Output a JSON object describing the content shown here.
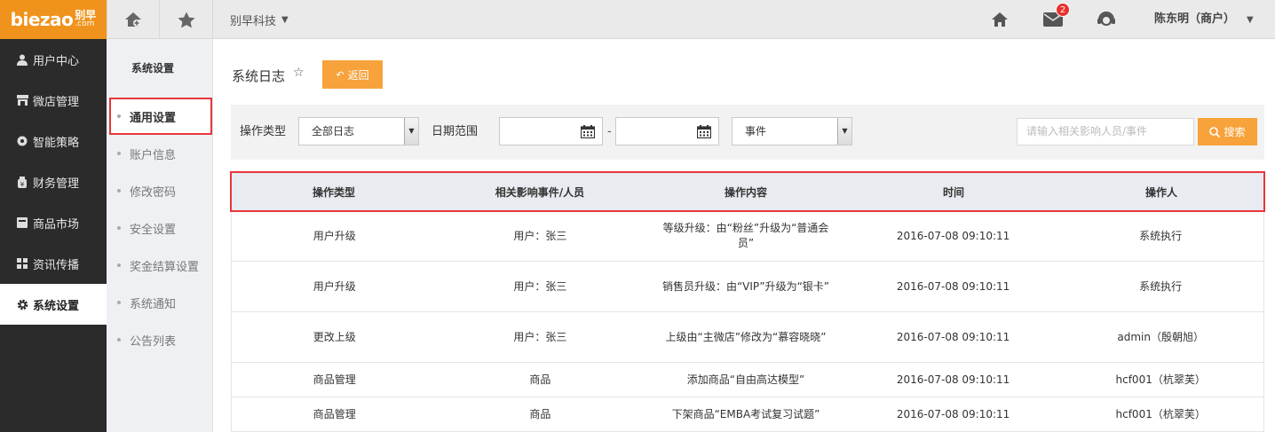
{
  "brand": {
    "logo_main": "biezao",
    "logo_cn": "别早",
    "logo_domain": ".com",
    "color": "#f0931c"
  },
  "topbar": {
    "company": "别早科技",
    "mail_badge": "2",
    "user": "陈东明（商户）"
  },
  "leftnav": {
    "items": [
      {
        "label": "用户中心",
        "icon": "user-icon"
      },
      {
        "label": "微店管理",
        "icon": "store-icon"
      },
      {
        "label": "智能策略",
        "icon": "bulb-icon"
      },
      {
        "label": "财务管理",
        "icon": "wallet-icon"
      },
      {
        "label": "商品市场",
        "icon": "market-icon"
      },
      {
        "label": "资讯传播",
        "icon": "grid-icon"
      },
      {
        "label": "系统设置",
        "icon": "gear-icon",
        "active": true
      }
    ]
  },
  "subnav": {
    "title": "系统设置",
    "items": [
      {
        "label": "通用设置",
        "active": true
      },
      {
        "label": "账户信息"
      },
      {
        "label": "修改密码"
      },
      {
        "label": "安全设置"
      },
      {
        "label": "奖金结算设置"
      },
      {
        "label": "系统通知"
      },
      {
        "label": "公告列表"
      }
    ]
  },
  "main": {
    "title": "系统日志",
    "back_label": "返回"
  },
  "filter": {
    "type_label": "操作类型",
    "type_value": "全部日志",
    "date_label": "日期范围",
    "date_sep": "-",
    "event_value": "事件",
    "search_placeholder": "请输入相关影响人员/事件",
    "search_label": "搜索"
  },
  "table": {
    "headers": [
      "操作类型",
      "相关影响事件/人员",
      "操作内容",
      "时间",
      "操作人"
    ],
    "rows": [
      [
        "用户升级",
        "用户：张三",
        "等级升级：由“粉丝”升级为“普通会员”",
        "2016-07-08 09:10:11",
        "系统执行"
      ],
      [
        "用户升级",
        "用户：张三",
        "销售员升级：由“VIP”升级为“银卡”",
        "2016-07-08 09:10:11",
        "系统执行"
      ],
      [
        "更改上级",
        "用户：张三",
        "上级由“主微店”修改为“慕容晓晓”",
        "2016-07-08 09:10:11",
        "admin（殷朝旭）"
      ],
      [
        "商品管理",
        "商品",
        "添加商品“自由高达模型”",
        "2016-07-08 09:10:11",
        "hcf001（杭翠芙）"
      ],
      [
        "商品管理",
        "商品",
        "下架商品“EMBA考试复习试题”",
        "2016-07-08 09:10:11",
        "hcf001（杭翠芙）"
      ]
    ]
  }
}
